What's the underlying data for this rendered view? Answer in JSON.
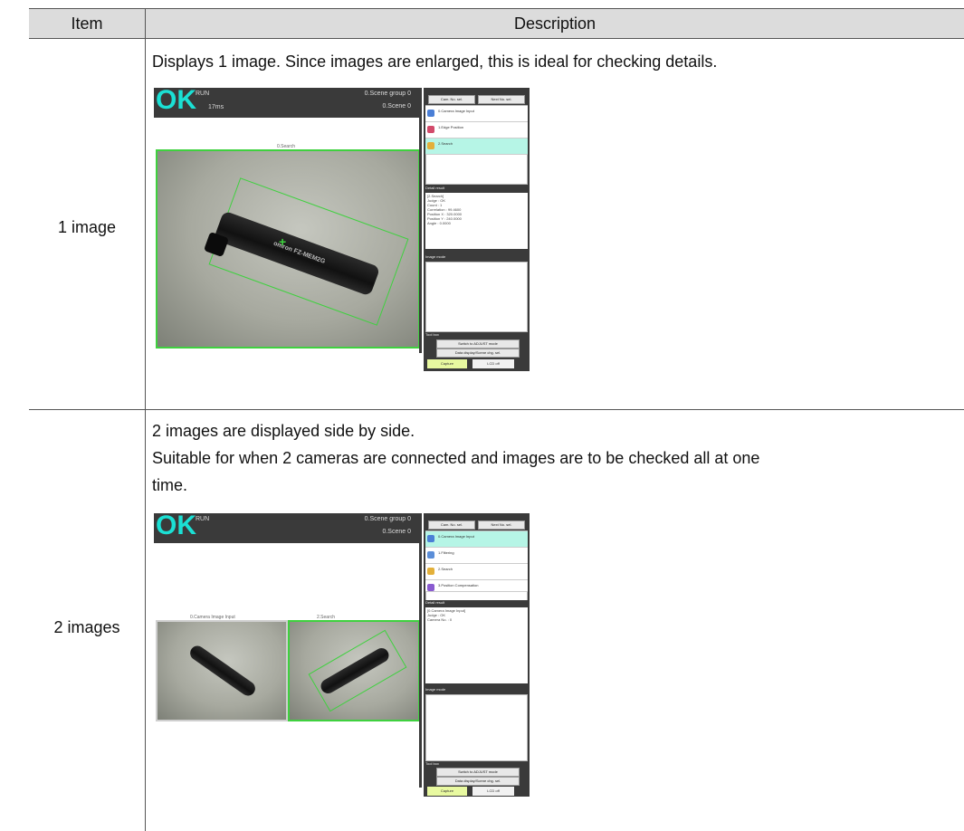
{
  "table": {
    "header": {
      "item": "Item",
      "description": "Description"
    },
    "rows": [
      {
        "item": "1 image",
        "description": [
          "Displays 1 image. Since images are enlarged, this is ideal for checking details."
        ],
        "screenshot": {
          "status": "OK",
          "run": "RUN",
          "time": "17ms",
          "scene_group": "0.Scene group 0",
          "scene": "0.Scene 0",
          "image_titles": [
            "0.Search"
          ],
          "device_text": "omron FZ-MEM2G",
          "flow_items": [
            "0.Camera Image Input",
            "1.Edge Position",
            "2.Search"
          ],
          "buttons": [
            "Cam. No. sel.",
            "Next No. sel."
          ],
          "detail_title": "Detail result",
          "detail_lines": [
            "[2.Search]",
            "",
            "Judge : OK",
            "Count : 1",
            "Correlation : 99.4600",
            "Position X : 320.0000",
            "Position Y : 240.0000",
            "Angle : 0.0000"
          ],
          "image_mode_title": "Image mode",
          "tool_box_title": "Tool box",
          "tool_buttons": [
            "Switch to ADJUST mode",
            "Data display/Scene chg. sel."
          ],
          "capture_label": "Capture",
          "lcd_label": "LCD off",
          "accent_color": "#3fd13f",
          "ok_color": "#1be0d4",
          "selected_flow_color": "#b6f5e6"
        }
      },
      {
        "item": "2 images",
        "description": [
          "2 images are displayed side by side.",
          "Suitable for when 2 cameras are connected and images are to be checked all at one",
          "time."
        ],
        "screenshot": {
          "status": "OK",
          "run": "RUN",
          "scene_group": "0.Scene group 0",
          "scene": "0.Scene 0",
          "image_titles": [
            "0.Camera Image Input",
            "2.Search"
          ],
          "flow_items": [
            "0.Camera Image Input",
            "1.Filtering",
            "2.Search",
            "3.Position Compensation"
          ],
          "buttons": [
            "Cam. No. sel.",
            "Next No. sel."
          ],
          "detail_title": "Detail result",
          "detail_lines": [
            "[0.Camera Image Input]",
            "",
            "Judge : OK",
            "Camera No. : 0"
          ],
          "image_mode_title": "Image mode",
          "tool_box_title": "Tool box",
          "tool_buttons": [
            "Switch to ADJUST mode",
            "Data display/Scene chg. sel."
          ],
          "capture_label": "Capture",
          "lcd_label": "LCD off"
        }
      }
    ]
  }
}
